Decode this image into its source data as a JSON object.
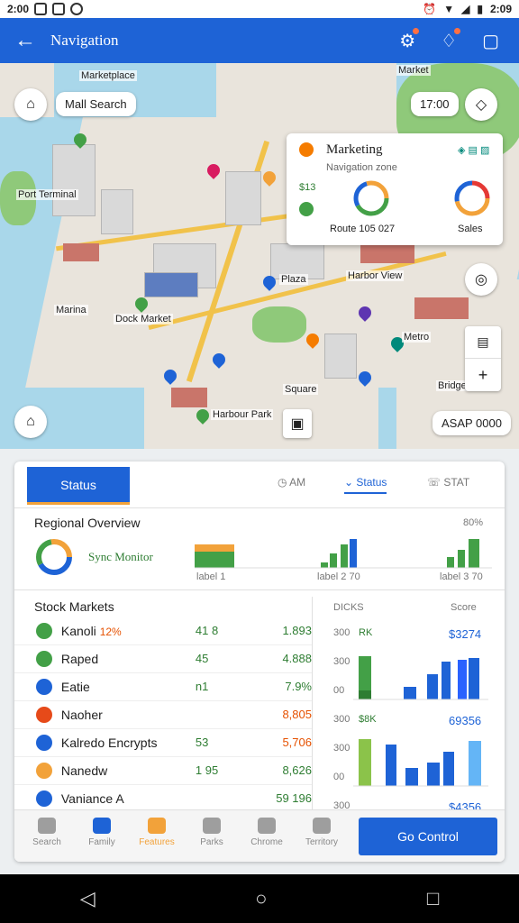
{
  "status": {
    "time": "2:00",
    "clock": "2:09"
  },
  "appbar": {
    "title": "Navigation",
    "back_icon": "arrow-left-icon",
    "actions": [
      "settings-icon",
      "alert-icon",
      "chat-icon"
    ]
  },
  "map": {
    "labels": {
      "top_left": "Marketplace",
      "search_chip": "Mall Search",
      "top_right_chip": "17:00",
      "bottom_right_chip": "ASAP 0000"
    },
    "place_names": [
      "Plaza",
      "Port Terminal",
      "Marina",
      "Dock Market",
      "Harbor View",
      "Metro",
      "Square",
      "Bridge",
      "Harbour Park",
      "Market"
    ],
    "infocard": {
      "title": "Marketing",
      "subtitle": "Navigation zone",
      "code": "$13",
      "footer_left": "Route 105 027",
      "footer_right": "Sales"
    }
  },
  "panel": {
    "tabs": {
      "active": "Status",
      "tab2": "AM",
      "tab3": "Status",
      "tab4": "STAT"
    },
    "overview": {
      "title": "Regional Overview",
      "donut_label": "Sync Monitor",
      "corner": "80%",
      "axis1": "label 1",
      "axis2": "label 2 70",
      "axis3": "label 3 70"
    },
    "list_title": "Stock Markets",
    "list": [
      {
        "name": "Kanoli",
        "extra": "12%",
        "mid": "41 8",
        "value": "1.893",
        "icon_color": "#43a047",
        "value_color": "#2e7d32"
      },
      {
        "name": "Raped",
        "extra": "",
        "mid": "45",
        "value": "4.888",
        "icon_color": "#43a047",
        "value_color": "#2e7d32"
      },
      {
        "name": "Eatie",
        "extra": "",
        "mid": "n1",
        "value": "7.9%",
        "icon_color": "#1e63d6",
        "value_color": "#2e7d32"
      },
      {
        "name": "Naoher",
        "extra": "",
        "mid": "",
        "value": "8,805",
        "icon_color": "#e64a19",
        "value_color": "#e65100"
      },
      {
        "name": "Kalredo Encrypts",
        "extra": "",
        "mid": "53",
        "value": "5,706",
        "icon_color": "#1e63d6",
        "value_color": "#e65100"
      },
      {
        "name": "Nanedw",
        "extra": "",
        "mid": "1 95",
        "value": "8,626",
        "icon_color": "#f2a23a",
        "value_color": "#2e7d32"
      },
      {
        "name": "Vaniance A",
        "extra": "",
        "mid": "",
        "value": "59 196",
        "icon_color": "#1e63d6",
        "value_color": "#2e7d32"
      }
    ],
    "right_header": {
      "col1": "DICKS",
      "col2": "Score"
    },
    "right_rows": [
      {
        "left": "300",
        "mid": "RK",
        "right": "$3274"
      },
      {
        "left": "300",
        "mid": "",
        "right": ""
      },
      {
        "left": "00",
        "mid": "",
        "right": ""
      },
      {
        "left": "300",
        "mid": "$8K",
        "right": "69356"
      },
      {
        "left": "300",
        "mid": "",
        "right": ""
      },
      {
        "left": "00",
        "mid": "",
        "right": ""
      },
      {
        "left": "300",
        "mid": "",
        "right": "$4356"
      }
    ],
    "bottom_nav": [
      "Search",
      "Family",
      "Features",
      "Parks",
      "Chrome",
      "Territory"
    ],
    "cta": "Go Control"
  },
  "colors": {
    "primary": "#1e63d6",
    "accent": "#f2a23a",
    "green": "#43a047"
  }
}
